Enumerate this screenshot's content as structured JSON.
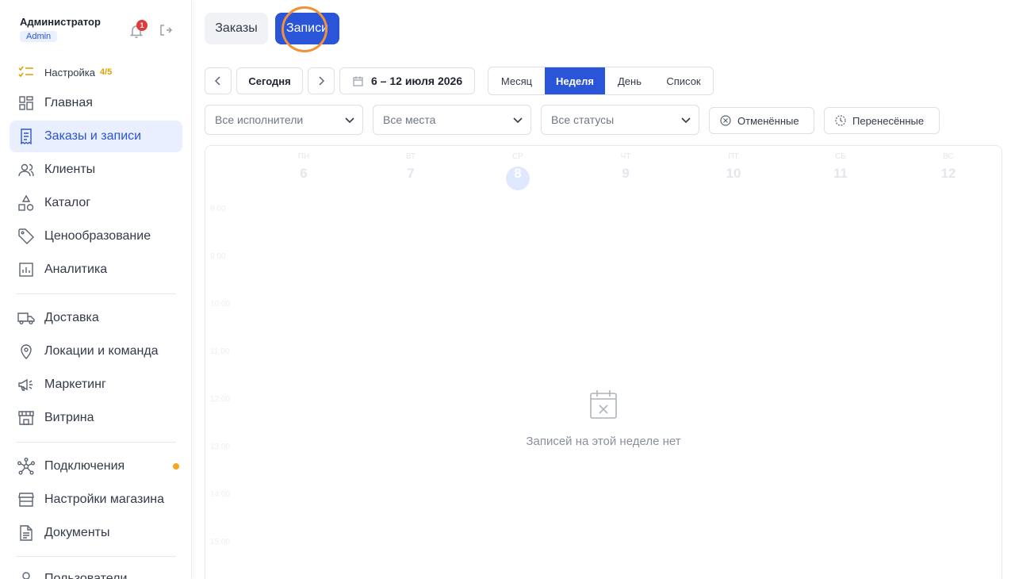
{
  "user": {
    "name": "Администратор",
    "role": "Admin",
    "notifications": "1"
  },
  "sidebar": {
    "setup": {
      "label": "Настройка",
      "progress": "4/5"
    },
    "items": [
      {
        "label": "Главная",
        "icon": "grid-icon"
      },
      {
        "label": "Заказы и записи",
        "icon": "receipt-icon",
        "active": true
      },
      {
        "label": "Клиенты",
        "icon": "users-icon"
      },
      {
        "label": "Каталог",
        "icon": "shapes-icon"
      },
      {
        "label": "Ценообразование",
        "icon": "tag-icon"
      },
      {
        "label": "Аналитика",
        "icon": "chart-icon"
      },
      {
        "label": "Доставка",
        "icon": "truck-icon"
      },
      {
        "label": "Локации и команда",
        "icon": "pin-icon"
      },
      {
        "label": "Маркетинг",
        "icon": "megaphone-icon"
      },
      {
        "label": "Витрина",
        "icon": "storefront-icon"
      },
      {
        "label": "Подключения",
        "icon": "network-icon"
      },
      {
        "label": "Настройки магазина",
        "icon": "store-icon"
      },
      {
        "label": "Документы",
        "icon": "document-icon"
      },
      {
        "label": "Пользователи",
        "icon": "user-icon"
      }
    ]
  },
  "main": {
    "segments": {
      "orders": "Заказы",
      "records": "Записи"
    },
    "toolbar": {
      "today": "Сегодня",
      "range": "6 – 12 июля 2026"
    },
    "views": [
      "Месяц",
      "Неделя",
      "День",
      "Список"
    ],
    "active_view": "Неделя",
    "filters": {
      "performers": "Все исполнители",
      "places": "Все места",
      "statuses": "Все статусы",
      "cancelled": "Отменённые",
      "rescheduled": "Перенесённые"
    },
    "calendar": {
      "days": [
        {
          "name": "ПН",
          "date": "6"
        },
        {
          "name": "ВТ",
          "date": "7"
        },
        {
          "name": "СР",
          "date": "8"
        },
        {
          "name": "ЧТ",
          "date": "9"
        },
        {
          "name": "ПТ",
          "date": "10"
        },
        {
          "name": "СБ",
          "date": "11"
        },
        {
          "name": "ВС",
          "date": "12"
        }
      ],
      "hours": [
        "8:00",
        "9:00",
        "10:00",
        "11:00",
        "12:00",
        "13:00",
        "14:00",
        "15:00"
      ],
      "empty_text": "Записей на этой неделе нет"
    }
  },
  "colors": {
    "accent": "#2a55d8",
    "active_bg": "#e9efff",
    "warning": "#f5a623",
    "badge": "#e23b3b",
    "click_ring": "#f0923a"
  }
}
